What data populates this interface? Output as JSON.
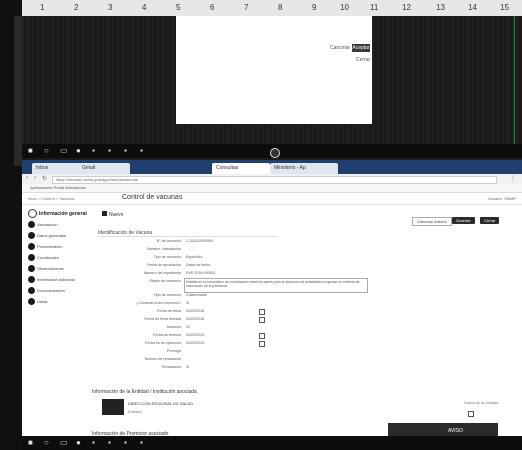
{
  "ruler": {
    "ticks": [
      "1",
      "2",
      "3",
      "4",
      "5",
      "6",
      "7",
      "8",
      "9",
      "10",
      "11",
      "12",
      "13",
      "14",
      "15"
    ]
  },
  "top_window": {
    "left_button": "Cancelar",
    "right_button": "Aceptar",
    "link": "Cerrar"
  },
  "browser": {
    "tabs": [
      "Inbox",
      "Gmail",
      "Consultas",
      "Ministerio - Ap"
    ],
    "url": "https://intranet.minsa.gob/app/control/vacunas",
    "bookmarks": "Aplicaciones  Portal  Marcadores"
  },
  "app": {
    "breadcrumb": "Inicio > Control > Vacunas",
    "title": "Control de vacunas",
    "user": "Usuario: SMMP",
    "nav": {
      "active": "Información general",
      "items": [
        "Vacunación",
        "Datos generales",
        "Procedimiento",
        "Condiciones",
        "Observaciones",
        "Información adicional",
        "Documentación",
        "Listas"
      ]
    },
    "toolbar": {
      "title": "Nuevo",
      "buttons": [
        "Cancelar edición",
        "Guardar",
        "Cerrar"
      ]
    },
    "section_title": "Identificación de Vacuna",
    "fields": [
      {
        "label": "N° de convenio",
        "value": "C-2018-0000000"
      },
      {
        "label": "Nombre / descripción",
        "value": ""
      },
      {
        "label": "Tipo de convenio",
        "value": "Específico"
      },
      {
        "label": "Fecha de aprobación",
        "value": "Datos de fecha"
      },
      {
        "label": "Número del expediente",
        "value": "EXP-2018-000001"
      },
      {
        "label": "Objeto del convenio",
        "value": ""
      },
      {
        "label": "Tipo de convenio",
        "value": "Colaboración"
      },
      {
        "label": "¿Convenio a otro convenio?",
        "value": "Sí"
      },
      {
        "label": "Fecha de firma",
        "value": "01/02/2018"
      },
      {
        "label": "Fecha de firma entidad",
        "value": "01/02/2018"
      },
      {
        "label": "Duración",
        "value": "12"
      },
      {
        "label": "Fecha de término",
        "value": "01/02/2019"
      },
      {
        "label": "Fecha fin de ejecución",
        "value": "01/02/2019"
      },
      {
        "label": "Prórroga",
        "value": ""
      },
      {
        "label": "Número de renovación",
        "value": ""
      },
      {
        "label": "Renovación",
        "value": "Sí"
      }
    ],
    "textarea_text": "Establecer el mecanismo de coordinación entre las partes para la ejecución de actividades conjuntas en materia de vacunación de la población.",
    "association_title": "Información de la Entidad / Institución asociada",
    "association_name": "DIRECCIÓN REGIONAL DE SALUD",
    "association_sub": "Entidad",
    "association_right": "Datos de la entidad",
    "promoter_title": "Información de Promotor asociado"
  },
  "toast": {
    "text": "AVISO"
  }
}
